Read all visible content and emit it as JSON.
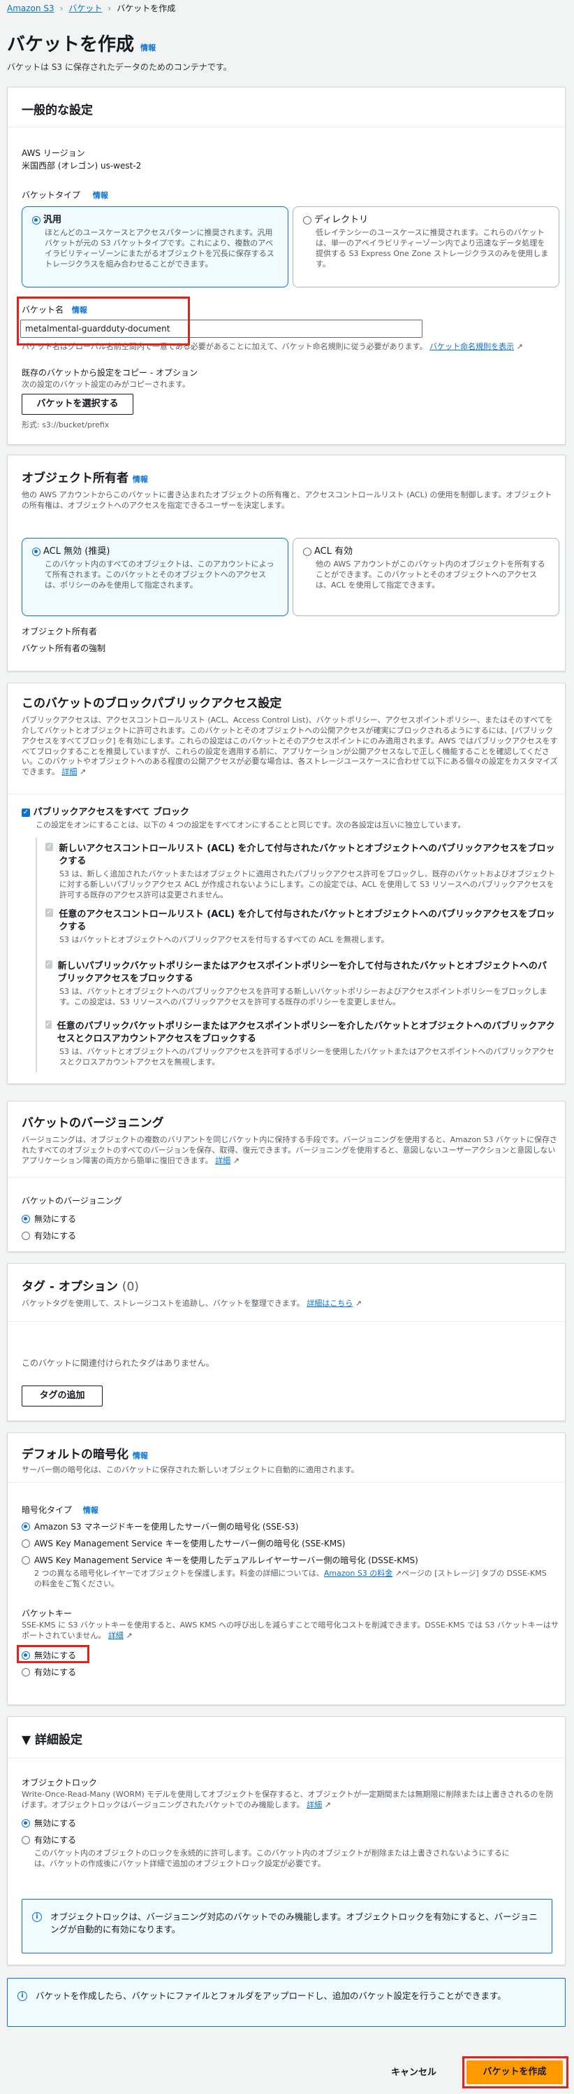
{
  "breadcrumb": {
    "home": "Amazon S3",
    "buckets": "バケット",
    "current": "バケットを作成"
  },
  "page": {
    "title": "バケットを作成",
    "info": "情報",
    "desc": "バケットは S3 に保存されたデータのためのコンテナです。"
  },
  "general": {
    "title": "一般的な設定",
    "region_label": "AWS リージョン",
    "region_value": "米国西部 (オレゴン) us-west-2",
    "type_label": "バケットタイプ",
    "info": "情報",
    "type_general_title": "汎用",
    "type_general_desc": "ほとんどのユースケースとアクセスパターンに推奨されます。汎用バケットが元の S3 バケットタイプです。これにより、複数のアベイラビリティーゾーンにまたがるオブジェクトを冗長に保存するストレージクラスを組み合わせることができます。",
    "type_dir_title": "ディレクトリ",
    "type_dir_desc": "低レイテンシーのユースケースに推奨されます。これらのバケットは、単一のアベイラビリティーゾーン内でより迅速なデータ処理を提供する S3 Express One Zone ストレージクラスのみを使用します。",
    "name_label": "バケット名",
    "name_value": "metalmental-guardduty-document",
    "name_hint": "バケット名はグローバル名前空間内で一意である必要があることに加えて、バケット命名規則に従う必要があります。",
    "name_rules_link": "バケット命名規則を表示",
    "copy_label": "既存のバケットから設定をコピー - オプション",
    "copy_desc": "次の設定のバケット設定のみがコピーされます。",
    "choose_bucket_btn": "バケットを選択する",
    "format_hint": "形式: s3://bucket/prefix"
  },
  "ownership": {
    "title": "オブジェクト所有者",
    "info": "情報",
    "desc": "他の AWS アカウントからこのバケットに書き込まれたオブジェクトの所有権と、アクセスコントロールリスト (ACL) の使用を制御します。オブジェクトの所有権は、オブジェクトへのアクセスを指定できるユーザーを決定します。",
    "acl_off_title": "ACL 無効 (推奨)",
    "acl_off_desc": "このバケット内のすべてのオブジェクトは、このアカウントによって所有されます。このバケットとそのオブジェクトへのアクセスは、ポリシーのみを使用して指定されます。",
    "acl_on_title": "ACL 有効",
    "acl_on_desc": "他の AWS アカウントがこのバケット内のオブジェクトを所有することができます。このバケットとそのオブジェクトへのアクセスは、ACL を使用して指定できます。",
    "owner_label": "オブジェクト所有者",
    "owner_value": "バケット所有者の強制"
  },
  "block": {
    "title": "このバケットのブロックパブリックアクセス設定",
    "desc": "パブリックアクセスは、アクセスコントロールリスト (ACL、Access Control List)、バケットポリシー、アクセスポイントポリシー、またはそのすべてを介してバケットとオブジェクトに許可されます。このバケットとそのオブジェクトへの公開アクセスが確実にブロックされるようにするには、[パブリックアクセスをすべてブロック] を有効にします。これらの設定はこのバケットとそのアクセスポイントにのみ適用されます。AWS ではパブリックアクセスをすべてブロックすることを推奨していますが、これらの設定を適用する前に、アプリケーションが公開アクセスなしで正しく機能することを確認してください。このバケットやオブジェクトへのある程度の公開アクセスが必要な場合は、各ストレージユースケースに合わせて以下にある個々の設定をカスタマイズできます。",
    "detail_link": "詳細",
    "all_title": "パブリックアクセスをすべて ブロック",
    "all_desc": "この設定をオンにすることは、以下の 4 つの設定をすべてオンにすることと同じです。次の各設定は互いに独立しています。",
    "items": [
      {
        "title": "新しいアクセスコントロールリスト (ACL) を介して付与されたバケットとオブジェクトへのパブリックアクセスをブロックする",
        "desc": "S3 は、新しく追加されたバケットまたはオブジェクトに適用されたパブリックアクセス許可をブロックし、既存のバケットおよびオブジェクトに対する新しいパブリックアクセス ACL が作成されないようにします。この設定では、ACL を使用して S3 リソースへのパブリックアクセスを許可する既存のアクセス許可は変更されません。"
      },
      {
        "title": "任意のアクセスコントロールリスト (ACL) を介して付与されたバケットとオブジェクトへのパブリックアクセスをブロックする",
        "desc": "S3 はバケットとオブジェクトへのパブリックアクセスを付与するすべての ACL を無視します。"
      },
      {
        "title": "新しいパブリックバケットポリシーまたはアクセスポイントポリシーを介して付与されたバケットとオブジェクトへのパブリックアクセスをブロックする",
        "desc": "S3 は、バケットとオブジェクトへのパブリックアクセスを許可する新しいバケットポリシーおよびアクセスポイントポリシーをブロックします。この設定は、S3 リソースへのパブリックアクセスを許可する既存のポリシーを変更しません。"
      },
      {
        "title": "任意のパブリックバケットポリシーまたはアクセスポイントポリシーを介したバケットとオブジェクトへのパブリックアクセスとクロスアカウントアクセスをブロックする",
        "desc": "S3 は、バケットとオブジェクトへのパブリックアクセスを許可するポリシーを使用したバケットまたはアクセスポイントへのパブリックアクセスとクロスアカウントアクセスを無視します。"
      }
    ]
  },
  "versioning": {
    "title": "バケットのバージョニング",
    "desc": "バージョニングは、オブジェクトの複数のバリアントを同じバケット内に保持する手段です。バージョニングを使用すると、Amazon S3 バケットに保存されたすべてのオブジェクトのすべてのバージョンを保存、取得、復元できます。バージョニングを使用すると、意図しないユーザーアクションと意図しないアプリケーション障害の両方から簡単に復旧できます。",
    "detail_link": "詳細",
    "label": "バケットのバージョニング",
    "opt_off": "無効にする",
    "opt_on": "有効にする"
  },
  "tags": {
    "title": "タグ - オプション",
    "count": "(0)",
    "desc": "バケットタグを使用して、ストレージコストを追跡し、バケットを整理できます。",
    "detail_link": "詳細はこちら",
    "empty": "このバケットに関連付けられたタグはありません。",
    "add_btn": "タグの追加"
  },
  "encryption": {
    "title": "デフォルトの暗号化",
    "info": "情報",
    "desc": "サーバー側の暗号化は、このバケットに保存された新しいオブジェクトに自動的に適用されます。",
    "type_label": "暗号化タイプ",
    "opt1": "Amazon S3 マネージドキーを使用したサーバー側の暗号化 (SSE-S3)",
    "opt2": "AWS Key Management Service キーを使用したサーバー側の暗号化 (SSE-KMS)",
    "opt3": "AWS Key Management Service キーを使用したデュアルレイヤーサーバー側の暗号化 (DSSE-KMS)",
    "opt3_desc_a": "2 つの異なる暗号化レイヤーでオブジェクトを保護します。料金の詳細については、",
    "opt3_link": "Amazon S3 の料金",
    "opt3_desc_b": "ページの [ストレージ] タブの DSSE-KMS の料金をご覧ください。",
    "key_label": "バケットキー",
    "key_desc": "SSE-KMS に S3 バケットキーを使用すると、AWS KMS への呼び出しを減らすことで暗号化コストを削減できます。DSSE-KMS では S3 バケットキーはサポートされていません。",
    "detail_link": "詳細",
    "key_off": "無効にする",
    "key_on": "有効にする"
  },
  "advanced": {
    "title": "詳細設定",
    "lock_label": "オブジェクトロック",
    "lock_desc": "Write-Once-Read-Many (WORM) モデルを使用してオブジェクトを保存すると、オブジェクトが一定期間または無期限に削除または上書きされるのを防げます。オブジェクトロックはバージョニングされたバケットでのみ機能します。",
    "detail_link": "詳細",
    "opt_off": "無効にする",
    "opt_on": "有効にする",
    "opt_on_desc": "このバケット内のオブジェクトのロックを永続的に許可します。このバケット内のオブジェクトが削除または上書きされないようにするには、バケットの作成後にバケット詳細で追加のオブジェクトロック設定が必要です。",
    "alert": "オブジェクトロックは、バージョニング対応のバケットでのみ機能します。オブジェクトロックを有効にすると、バージョニングが自動的に有効になります。"
  },
  "footer_alert": "バケットを作成したら、バケットにファイルとフォルダをアップロードし、追加のバケット設定を行うことができます。",
  "actions": {
    "cancel": "キャンセル",
    "create": "バケットを作成"
  },
  "colors": {
    "accent": "#0972d3",
    "primary": "#ff9900",
    "highlight": "#e3221c"
  }
}
